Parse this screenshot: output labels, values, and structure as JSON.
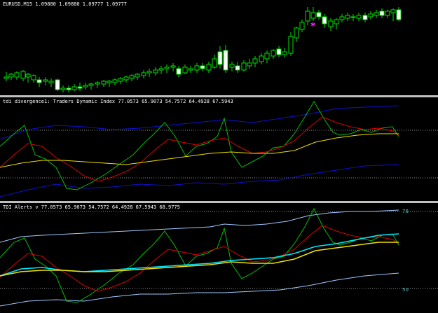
{
  "colors": {
    "background": "#000000",
    "separator": "#c0c0c0",
    "candle_outline": "#00e000",
    "bull_body": "#000000",
    "bear_body": "#ffffff",
    "tdi_band": "#1010d0",
    "tdi_green": "#00c000",
    "tdi_red": "#e00000",
    "tdi_yellow": "#f0e000",
    "alert_band": "#a0c8ff",
    "alert_cyan": "#00e8ff",
    "level_dots": "#909090",
    "signal_star": "#ff20ff"
  },
  "main_chart": {
    "title": "EURUSD,M15",
    "ohlc": "1.09880 1.09880 1.09777 1.09777",
    "signal_marker": "*"
  },
  "indicator1": {
    "title": "tdi divergence1: Traders Dynamic Index 77.0573 65.9073 54.7572 64.4928 67.5943"
  },
  "indicator2": {
    "title": "TDI Alerts v 77.0573 65.9073 54.7572 64.4928 67.5943 68.9775",
    "level_high": "78",
    "level_low": "50"
  }
}
